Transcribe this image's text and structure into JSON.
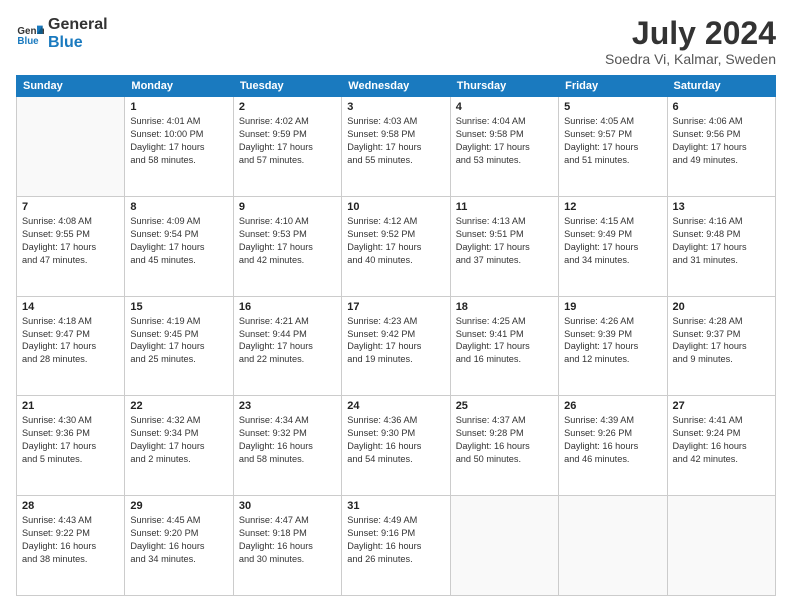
{
  "header": {
    "logo_line1": "General",
    "logo_line2": "Blue",
    "month_year": "July 2024",
    "location": "Soedra Vi, Kalmar, Sweden"
  },
  "days_of_week": [
    "Sunday",
    "Monday",
    "Tuesday",
    "Wednesday",
    "Thursday",
    "Friday",
    "Saturday"
  ],
  "weeks": [
    [
      {
        "day": "",
        "info": ""
      },
      {
        "day": "1",
        "info": "Sunrise: 4:01 AM\nSunset: 10:00 PM\nDaylight: 17 hours\nand 58 minutes."
      },
      {
        "day": "2",
        "info": "Sunrise: 4:02 AM\nSunset: 9:59 PM\nDaylight: 17 hours\nand 57 minutes."
      },
      {
        "day": "3",
        "info": "Sunrise: 4:03 AM\nSunset: 9:58 PM\nDaylight: 17 hours\nand 55 minutes."
      },
      {
        "day": "4",
        "info": "Sunrise: 4:04 AM\nSunset: 9:58 PM\nDaylight: 17 hours\nand 53 minutes."
      },
      {
        "day": "5",
        "info": "Sunrise: 4:05 AM\nSunset: 9:57 PM\nDaylight: 17 hours\nand 51 minutes."
      },
      {
        "day": "6",
        "info": "Sunrise: 4:06 AM\nSunset: 9:56 PM\nDaylight: 17 hours\nand 49 minutes."
      }
    ],
    [
      {
        "day": "7",
        "info": "Sunrise: 4:08 AM\nSunset: 9:55 PM\nDaylight: 17 hours\nand 47 minutes."
      },
      {
        "day": "8",
        "info": "Sunrise: 4:09 AM\nSunset: 9:54 PM\nDaylight: 17 hours\nand 45 minutes."
      },
      {
        "day": "9",
        "info": "Sunrise: 4:10 AM\nSunset: 9:53 PM\nDaylight: 17 hours\nand 42 minutes."
      },
      {
        "day": "10",
        "info": "Sunrise: 4:12 AM\nSunset: 9:52 PM\nDaylight: 17 hours\nand 40 minutes."
      },
      {
        "day": "11",
        "info": "Sunrise: 4:13 AM\nSunset: 9:51 PM\nDaylight: 17 hours\nand 37 minutes."
      },
      {
        "day": "12",
        "info": "Sunrise: 4:15 AM\nSunset: 9:49 PM\nDaylight: 17 hours\nand 34 minutes."
      },
      {
        "day": "13",
        "info": "Sunrise: 4:16 AM\nSunset: 9:48 PM\nDaylight: 17 hours\nand 31 minutes."
      }
    ],
    [
      {
        "day": "14",
        "info": "Sunrise: 4:18 AM\nSunset: 9:47 PM\nDaylight: 17 hours\nand 28 minutes."
      },
      {
        "day": "15",
        "info": "Sunrise: 4:19 AM\nSunset: 9:45 PM\nDaylight: 17 hours\nand 25 minutes."
      },
      {
        "day": "16",
        "info": "Sunrise: 4:21 AM\nSunset: 9:44 PM\nDaylight: 17 hours\nand 22 minutes."
      },
      {
        "day": "17",
        "info": "Sunrise: 4:23 AM\nSunset: 9:42 PM\nDaylight: 17 hours\nand 19 minutes."
      },
      {
        "day": "18",
        "info": "Sunrise: 4:25 AM\nSunset: 9:41 PM\nDaylight: 17 hours\nand 16 minutes."
      },
      {
        "day": "19",
        "info": "Sunrise: 4:26 AM\nSunset: 9:39 PM\nDaylight: 17 hours\nand 12 minutes."
      },
      {
        "day": "20",
        "info": "Sunrise: 4:28 AM\nSunset: 9:37 PM\nDaylight: 17 hours\nand 9 minutes."
      }
    ],
    [
      {
        "day": "21",
        "info": "Sunrise: 4:30 AM\nSunset: 9:36 PM\nDaylight: 17 hours\nand 5 minutes."
      },
      {
        "day": "22",
        "info": "Sunrise: 4:32 AM\nSunset: 9:34 PM\nDaylight: 17 hours\nand 2 minutes."
      },
      {
        "day": "23",
        "info": "Sunrise: 4:34 AM\nSunset: 9:32 PM\nDaylight: 16 hours\nand 58 minutes."
      },
      {
        "day": "24",
        "info": "Sunrise: 4:36 AM\nSunset: 9:30 PM\nDaylight: 16 hours\nand 54 minutes."
      },
      {
        "day": "25",
        "info": "Sunrise: 4:37 AM\nSunset: 9:28 PM\nDaylight: 16 hours\nand 50 minutes."
      },
      {
        "day": "26",
        "info": "Sunrise: 4:39 AM\nSunset: 9:26 PM\nDaylight: 16 hours\nand 46 minutes."
      },
      {
        "day": "27",
        "info": "Sunrise: 4:41 AM\nSunset: 9:24 PM\nDaylight: 16 hours\nand 42 minutes."
      }
    ],
    [
      {
        "day": "28",
        "info": "Sunrise: 4:43 AM\nSunset: 9:22 PM\nDaylight: 16 hours\nand 38 minutes."
      },
      {
        "day": "29",
        "info": "Sunrise: 4:45 AM\nSunset: 9:20 PM\nDaylight: 16 hours\nand 34 minutes."
      },
      {
        "day": "30",
        "info": "Sunrise: 4:47 AM\nSunset: 9:18 PM\nDaylight: 16 hours\nand 30 minutes."
      },
      {
        "day": "31",
        "info": "Sunrise: 4:49 AM\nSunset: 9:16 PM\nDaylight: 16 hours\nand 26 minutes."
      },
      {
        "day": "",
        "info": ""
      },
      {
        "day": "",
        "info": ""
      },
      {
        "day": "",
        "info": ""
      }
    ]
  ]
}
